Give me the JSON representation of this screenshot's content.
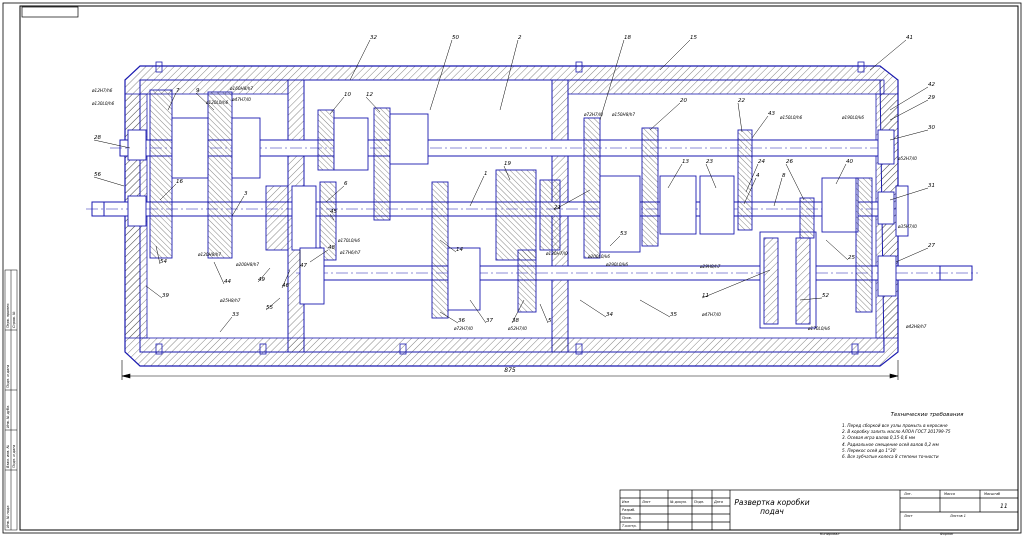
{
  "drawing": {
    "title": "Развертка коробки подач",
    "overall_dimension": "875",
    "sheet_code": "11",
    "callouts": [
      "32",
      "50",
      "2",
      "18",
      "15",
      "41",
      "7",
      "9",
      "10",
      "12",
      "20",
      "22",
      "43",
      "1",
      "19",
      "21",
      "13",
      "23",
      "24",
      "26",
      "40",
      "42",
      "29",
      "30",
      "31",
      "27",
      "25",
      "52",
      "11",
      "6",
      "4",
      "8",
      "3",
      "44",
      "16",
      "54",
      "39",
      "33",
      "34",
      "35",
      "36",
      "37",
      "38",
      "5",
      "48",
      "47",
      "46",
      "49",
      "14",
      "53",
      "28",
      "56",
      "45",
      "55"
    ],
    "fits": [
      "ø12Н7/h6",
      "ø130L0/h6",
      "ø160Н8/h7",
      "ø47Н7/l0",
      "ø120L0/h6",
      "ø72Н7/l0",
      "ø150Н8/h7",
      "ø150L0/h6",
      "ø190L0/k6",
      "ø52Н7/l0",
      "ø170L0/k6",
      "ø17Н6/h7",
      "ø130Н7/l0",
      "ø200L0/k6",
      "ø290L0/k6",
      "ø29Н8/h7",
      "ø120Н8/h7",
      "ø200Н8/h7",
      "ø25Н8/h7",
      "ø72Н7/l0",
      "ø52Н7/l0",
      "ø47Н7/l0",
      "ø170L0/k6",
      "ø35Н7/l0",
      "ø42Н8/h7"
    ]
  },
  "tech_requirements": {
    "title": "Технические требования",
    "items": [
      "1. Перед сборкой все узлы промыть в керосине",
      "2. В коробку залить масло АЛОА ГОСТ 201799-75",
      "3. Осевая игра валов 0,15-0,6 мм",
      "4. Радиальное смещение осей валов 0,2 мм",
      "5. Перекос осей до 1°30'",
      "6. Все зубчатые колеса 8 степени точности"
    ]
  },
  "title_block": {
    "headers": [
      "Изм",
      "Лист",
      "№ докум.",
      "Подп.",
      "Дата"
    ],
    "roles": [
      "Разраб.",
      "Пров.",
      "Т.контр.",
      "Н.контр.",
      "Утв."
    ],
    "cols": [
      "Лит.",
      "Масса",
      "Масштаб"
    ],
    "sheet": "Лист",
    "sheets": "Листов 1",
    "copied": "Копировал",
    "format": "Формат"
  },
  "side_stamp": {
    "items": [
      "Перв. примен.",
      "Справ. №",
      "Подп. и дата",
      "Инв. № дубл.",
      "Взам. инв. №",
      "Подп. и дата",
      "Инв. № подл."
    ]
  },
  "colors": {
    "lines": "#1a1ab0",
    "ink": "#000000",
    "hatch": "#3a3a3a"
  }
}
